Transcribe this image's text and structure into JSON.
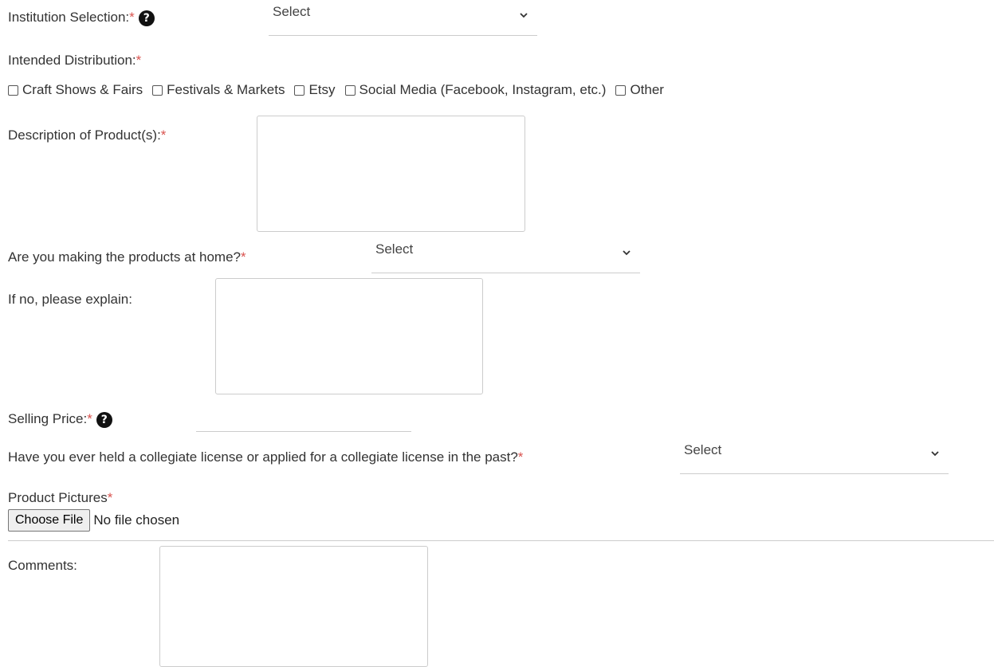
{
  "form": {
    "institution": {
      "label": "Institution Selection:",
      "required": "*",
      "help": "?",
      "value": "Select"
    },
    "distribution": {
      "label": "Intended Distribution:",
      "required": "*",
      "options": [
        "Craft Shows & Fairs",
        "Festivals & Markets",
        "Etsy",
        "Social Media (Facebook, Instagram, etc.)",
        "Other"
      ]
    },
    "description": {
      "label": "Description of Product(s):",
      "required": "*"
    },
    "home": {
      "label": "Are you making the products at home?",
      "required": "*",
      "value": "Select"
    },
    "explain": {
      "label": "If no, please explain:"
    },
    "price": {
      "label": "Selling Price:",
      "required": "*",
      "help": "?"
    },
    "license": {
      "label": "Have you ever held a collegiate license or applied for a collegiate license in the past?",
      "required": "*",
      "value": "Select"
    },
    "pictures": {
      "label": "Product Pictures",
      "required": "*",
      "button": "Choose File",
      "status": "No file chosen"
    },
    "comments": {
      "label": "Comments:"
    }
  }
}
